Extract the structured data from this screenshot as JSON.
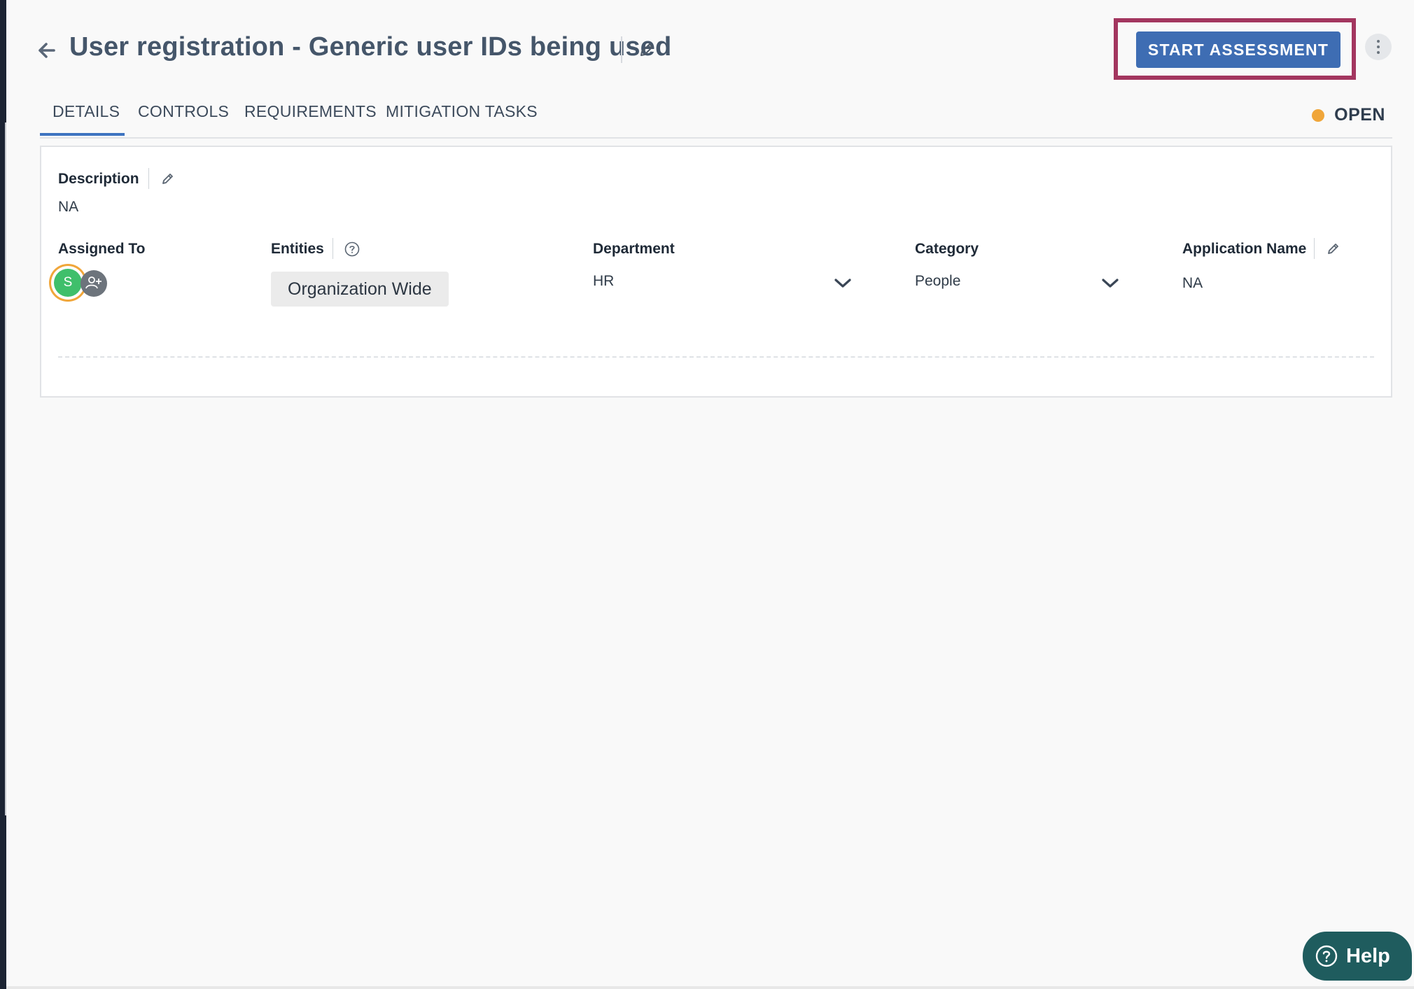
{
  "header": {
    "title": "User registration - Generic user IDs being used",
    "start_button_label": "START ASSESSMENT"
  },
  "tabs": [
    {
      "label": "DETAILS",
      "active": true
    },
    {
      "label": "CONTROLS",
      "active": false
    },
    {
      "label": "REQUIREMENTS",
      "active": false
    },
    {
      "label": "MITIGATION TASKS",
      "active": false
    }
  ],
  "status": {
    "label": "OPEN",
    "color": "#f0a63a"
  },
  "details": {
    "description_label": "Description",
    "description_value": "NA",
    "assigned_to_label": "Assigned To",
    "assignee_initial": "S",
    "entities_label": "Entities",
    "entities_value": "Organization Wide",
    "department_label": "Department",
    "department_value": "HR",
    "category_label": "Category",
    "category_value": "People",
    "application_name_label": "Application Name",
    "application_name_value": "NA"
  },
  "help": {
    "label": "Help"
  },
  "colors": {
    "primary": "#3e6db3",
    "highlight": "#a3365f",
    "tab_active": "#3e74c0",
    "avatar": "#3fbf6b",
    "help_bg": "#1f5c5e"
  },
  "icons": {
    "back": "arrow-left-icon",
    "edit": "pencil-icon",
    "more": "vertical-dots-icon",
    "info": "question-circle-icon",
    "add_user": "add-user-icon",
    "chevron": "chevron-down-icon",
    "help": "question-circle-icon"
  }
}
